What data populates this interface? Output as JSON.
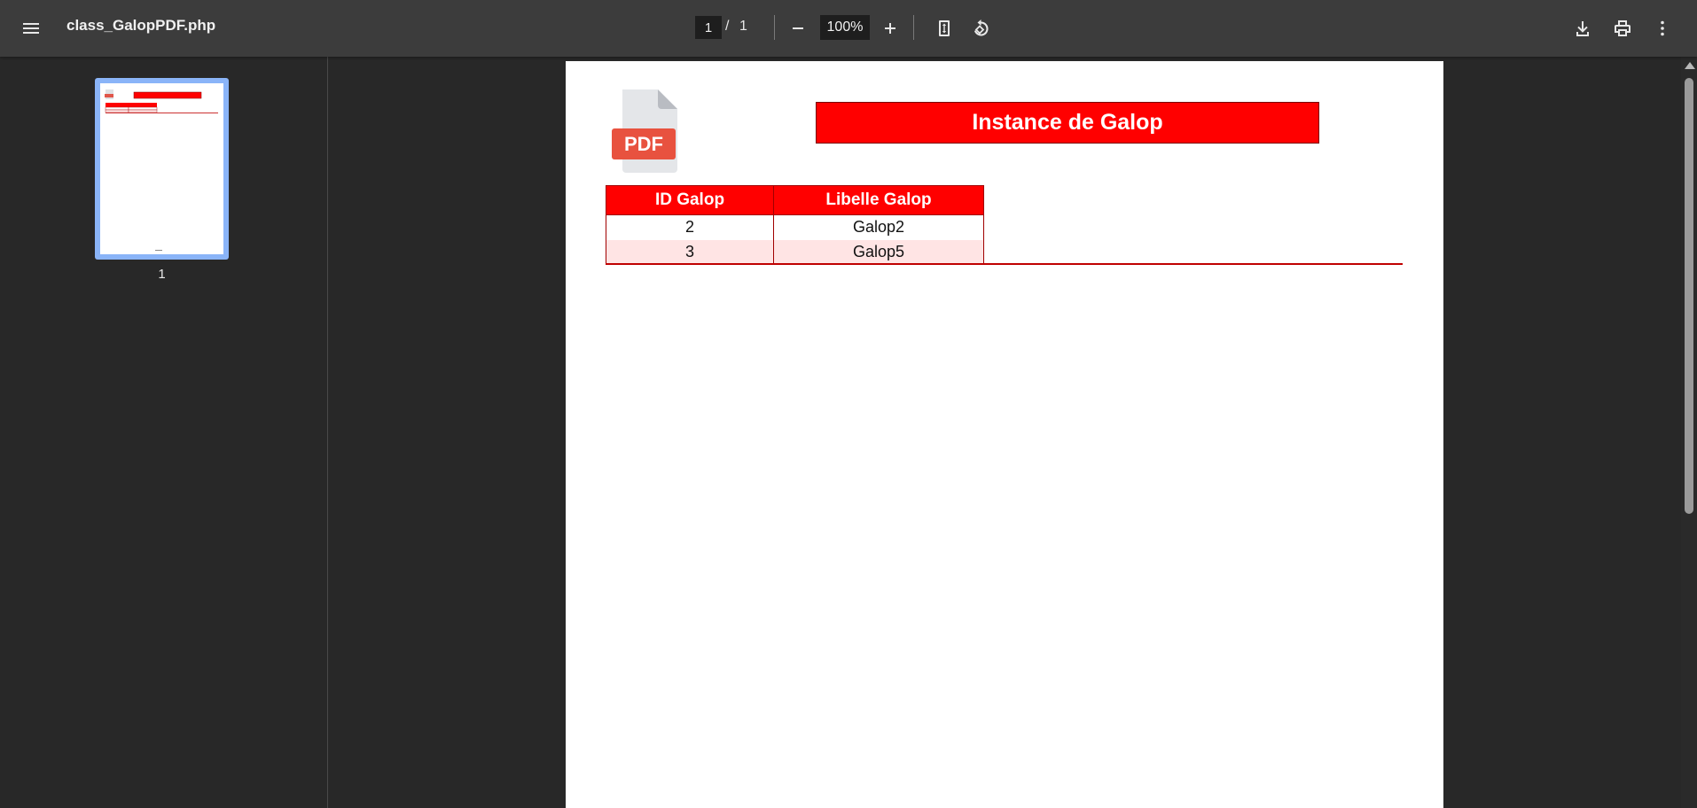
{
  "toolbar": {
    "document_title": "class_GalopPDF.php",
    "page_current": "1",
    "page_separator": "/",
    "page_total": "1",
    "zoom_value": "100%",
    "menu_icon": "hamburger-menu-icon",
    "zoom_out_icon": "minus-icon",
    "zoom_in_icon": "plus-icon",
    "fit_icon": "fit-to-page-icon",
    "rotate_icon": "rotate-counterclockwise-icon",
    "download_icon": "download-icon",
    "print_icon": "printer-icon",
    "more_icon": "more-vertical-icon"
  },
  "sidebar": {
    "thumbnails": [
      {
        "label": "1",
        "selected": true
      }
    ],
    "accent_color": "#8ab4f8"
  },
  "document": {
    "logo_text": "PDF",
    "title": "Instance de Galop",
    "table": {
      "headers": [
        "ID Galop",
        "Libelle Galop"
      ],
      "rows": [
        [
          "2",
          "Galop2"
        ],
        [
          "3",
          "Galop5"
        ]
      ]
    },
    "header_color": "#ff0000",
    "alt_row_color": "#ffe4e4"
  }
}
